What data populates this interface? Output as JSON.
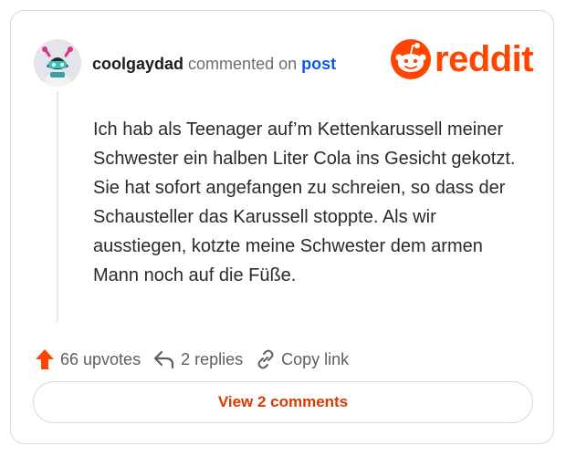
{
  "comment": {
    "username": "coolgaydad",
    "commented_on": "commented on",
    "post_link": "post",
    "body": "Ich hab als Teenager auf’m Kettenkarussell meiner Schwester ein halben Liter Cola ins Gesicht gekotzt. Sie hat sofort angefangen zu schreien, so dass der Schausteller das Karussell stoppte. Als wir ausstiegen, kotzte meine Schwester dem armen Mann noch auf die Füße."
  },
  "brand": {
    "wordmark": "reddit",
    "color": "#ff4500"
  },
  "actions": {
    "upvotes": "66 upvotes",
    "replies": "2 replies",
    "copy_link": "Copy link"
  },
  "view_comments": "View 2 comments",
  "icons": {
    "upvote": "upvote-arrow-icon",
    "reply": "reply-arrow-icon",
    "link": "link-icon",
    "logo": "reddit-snoo-icon",
    "avatar": "snoo-avatar"
  }
}
